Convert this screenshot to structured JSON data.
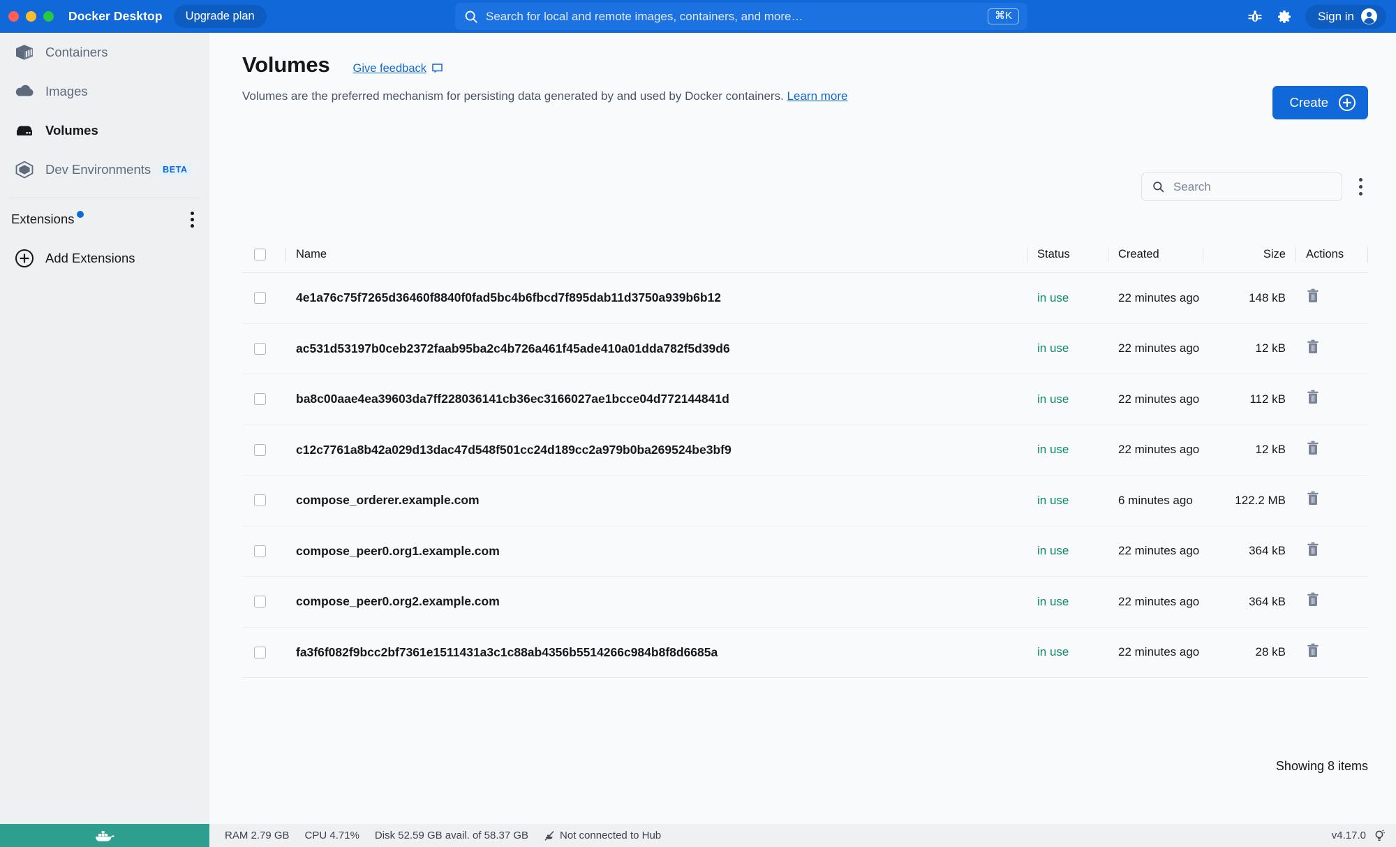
{
  "titlebar": {
    "app_title": "Docker Desktop",
    "upgrade_label": "Upgrade plan",
    "search_placeholder": "Search for local and remote images, containers, and more…",
    "search_shortcut": "⌘K",
    "bug_icon": "bug-icon",
    "settings_icon": "gear-icon",
    "signin_label": "Sign in",
    "accent": "#1168d9"
  },
  "sidebar": {
    "items": [
      {
        "label": "Containers",
        "icon": "container-icon",
        "active": false
      },
      {
        "label": "Images",
        "icon": "cloud-icon",
        "active": false
      },
      {
        "label": "Volumes",
        "icon": "volume-icon",
        "active": true
      },
      {
        "label": "Dev Environments",
        "icon": "dev-environments-icon",
        "badge": "BETA",
        "active": false
      }
    ],
    "extensions_label": "Extensions",
    "add_extensions_label": "Add Extensions"
  },
  "page": {
    "title": "Volumes",
    "feedback_label": "Give feedback",
    "description_prefix": "Volumes are the preferred mechanism for persisting data generated by and used by Docker containers. ",
    "learn_more_label": "Learn more",
    "create_label": "Create"
  },
  "toolbar": {
    "search_placeholder": "Search"
  },
  "table": {
    "columns": [
      "Name",
      "Status",
      "Created",
      "Size",
      "Actions"
    ],
    "rows": [
      {
        "name": "4e1a76c75f7265d36460f8840f0fad5bc4b6fbcd7f895dab11d3750a939b6b12",
        "status": "in use",
        "created": "22 minutes ago",
        "size": "148 kB"
      },
      {
        "name": "ac531d53197b0ceb2372faab95ba2c4b726a461f45ade410a01dda782f5d39d6",
        "status": "in use",
        "created": "22 minutes ago",
        "size": "12 kB"
      },
      {
        "name": "ba8c00aae4ea39603da7ff228036141cb36ec3166027ae1bcce04d772144841d",
        "status": "in use",
        "created": "22 minutes ago",
        "size": "112 kB"
      },
      {
        "name": "c12c7761a8b42a029d13dac47d548f501cc24d189cc2a979b0ba269524be3bf9",
        "status": "in use",
        "created": "22 minutes ago",
        "size": "12 kB"
      },
      {
        "name": "compose_orderer.example.com",
        "status": "in use",
        "created": "6 minutes ago",
        "size": "122.2 MB"
      },
      {
        "name": "compose_peer0.org1.example.com",
        "status": "in use",
        "created": "22 minutes ago",
        "size": "364 kB"
      },
      {
        "name": "compose_peer0.org2.example.com",
        "status": "in use",
        "created": "22 minutes ago",
        "size": "364 kB"
      },
      {
        "name": "fa3f6f082f9bcc2bf7361e1511431a3c1c88ab4356b5514266c984b8f8d6685a",
        "status": "in use",
        "created": "22 minutes ago",
        "size": "28 kB"
      }
    ],
    "showing_label": "Showing 8 items",
    "status_color": "#0f8a6a"
  },
  "statusbar": {
    "ram": "RAM 2.79 GB",
    "cpu": "CPU 4.71%",
    "disk": "Disk 52.59 GB avail. of 58.37 GB",
    "hub": "Not connected to Hub",
    "version": "v4.17.0"
  }
}
